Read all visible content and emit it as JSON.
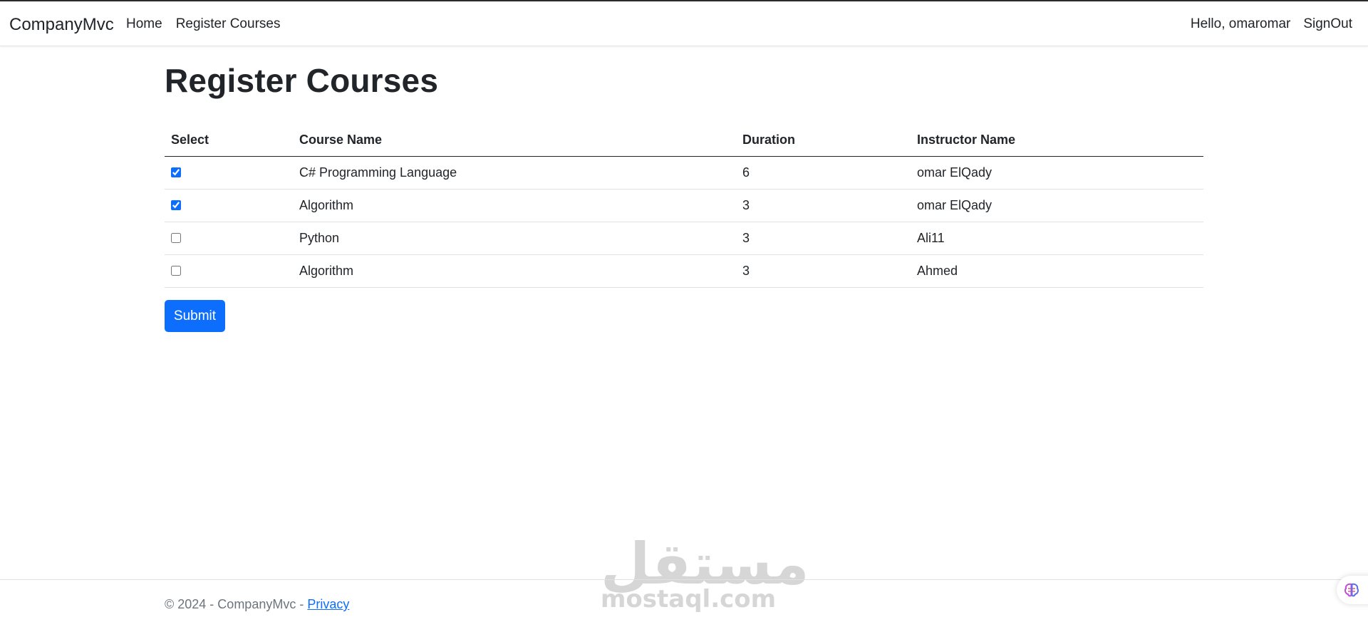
{
  "colors": {
    "primary": "#0d6efd",
    "text": "#212529",
    "muted": "#6c757d",
    "border": "#dee2e6"
  },
  "nav": {
    "brand": "CompanyMvc",
    "links": [
      "Home",
      "Register Courses"
    ],
    "greeting": "Hello, omaromar",
    "signout": "SignOut"
  },
  "page": {
    "title": "Register Courses"
  },
  "table": {
    "headers": [
      "Select",
      "Course Name",
      "Duration",
      "Instructor Name"
    ],
    "rows": [
      {
        "selected": true,
        "course": "C# Programming Language",
        "duration": "6",
        "instructor": "omar ElQady"
      },
      {
        "selected": true,
        "course": "Algorithm",
        "duration": "3",
        "instructor": "omar ElQady"
      },
      {
        "selected": false,
        "course": "Python",
        "duration": "3",
        "instructor": "Ali11"
      },
      {
        "selected": false,
        "course": "Algorithm",
        "duration": "3",
        "instructor": "Ahmed"
      }
    ]
  },
  "form": {
    "submit_label": "Submit"
  },
  "footer": {
    "copyright": "© 2024 - CompanyMvc - ",
    "privacy_label": "Privacy"
  },
  "watermark": {
    "arabic": "مستقل",
    "latin": "mostaql.com"
  },
  "icons": {
    "assistant": "brain-icon"
  }
}
